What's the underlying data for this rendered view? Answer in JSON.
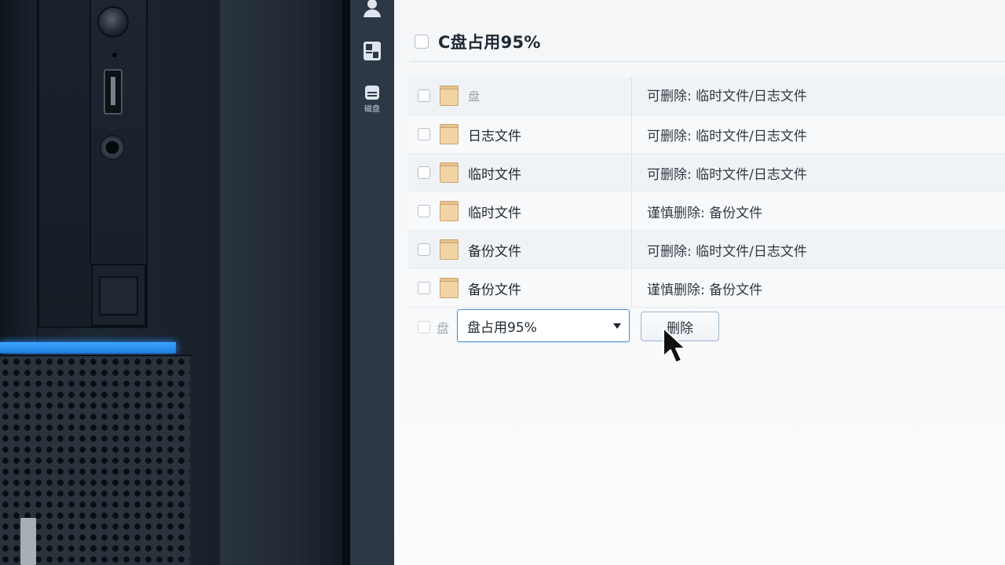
{
  "sidebar": {
    "items": [
      {
        "icon": "user-icon",
        "label": ""
      },
      {
        "icon": "dashboard-icon",
        "label": ""
      },
      {
        "icon": "storage-icon",
        "label": "磁盘"
      }
    ]
  },
  "header": {
    "title": "C盘占用95%"
  },
  "table": {
    "rows": [
      {
        "name": "盘",
        "description": "可删除: 临时文件/日志文件"
      },
      {
        "name": "日志文件",
        "description": "可删除: 临时文件/日志文件"
      },
      {
        "name": "临时文件",
        "description": "可删除: 临时文件/日志文件"
      },
      {
        "name": "临时文件",
        "description": "谨慎删除: 备份文件"
      },
      {
        "name": "备份文件",
        "description": "可删除: 临时文件/日志文件"
      },
      {
        "name": "备份文件",
        "description": "谨慎删除: 备份文件"
      }
    ]
  },
  "footer": {
    "label": "盘",
    "select_value": "盘占用95%",
    "delete_label": "删除"
  },
  "colors": {
    "sidebar_bg": "#2c3845",
    "accent_border": "#4d8fd8",
    "folder": "#f1d4a6",
    "led_strip": "#3aa6ff"
  }
}
